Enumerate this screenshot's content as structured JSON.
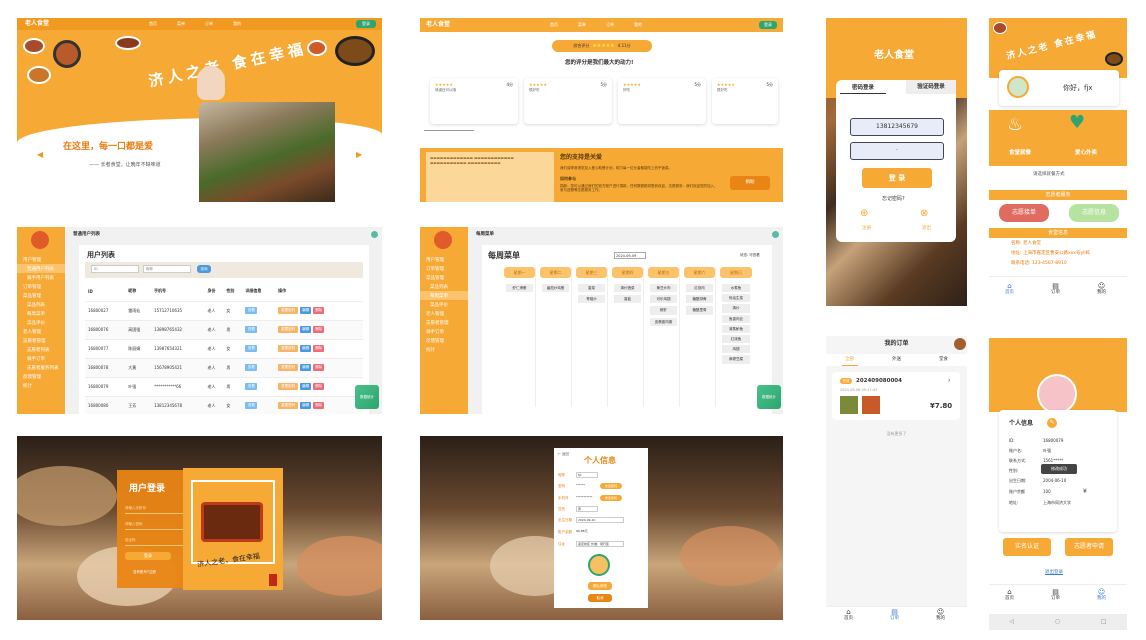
{
  "home": {
    "brand": "老人食堂",
    "nav": [
      "首页",
      "菜单",
      "订单",
      "我的"
    ],
    "login_btn": "登录",
    "banner_text": "济人之老 食在幸福",
    "slogan": "在这里，每一口都是爱",
    "sub_slogan": "—— 长者食堂，让晚年不缺味道"
  },
  "feedback": {
    "brand": "老人食堂",
    "nav": [
      "首页",
      "菜单",
      "订单",
      "我的"
    ],
    "login_btn": "登录",
    "rating_label": "综合评分",
    "rating_value": "4.11分",
    "headline": "您的评分是我们最大的动力!",
    "reviews": [
      {
        "score": "4分",
        "text": "味道还可以哦"
      },
      {
        "score": "5分",
        "text": "很好吃"
      },
      {
        "score": "5分",
        "text": "好吃"
      },
      {
        "score": "5分",
        "text": "很好吃"
      }
    ],
    "support_title": "您的支持是关爱",
    "support_text": "我们诚挚邀请您加入爱心助餐计划，助力每一位长者都能吃上热乎饭菜。",
    "support_subtitle": "如何参与",
    "support_detail": "捐款：您可以通过我们的官方账户进行捐款，任何数额都将受到欢迎。志愿服务：我们欢迎您的加入，参与送餐等志愿服务工作。",
    "support_btn": "捐助"
  },
  "mobile_login": {
    "brand": "老人食堂",
    "tab_password": "密码登录",
    "tab_code": "验证码登录",
    "phone_value": "13812345679",
    "password_value": "·",
    "login_btn": "登 录",
    "forgot": "忘记密码?",
    "register": "注册",
    "exit": "退出"
  },
  "mobile_home": {
    "banner_text": "济人之老 食在幸福",
    "greeting": "你好，fjx",
    "service1": "食堂就餐",
    "service2": "爱心外卖",
    "choose": "请选择就餐方式",
    "volunteer_section": "志愿者服务",
    "volunteer_order": "志愿接单",
    "volunteer_info": "志愿信息",
    "canteen_section": "食堂信息",
    "canteen_name_label": "名称:",
    "canteen_name": "老人食堂",
    "canteen_addr_label": "地址:",
    "canteen_addr": "上海市嘉定区曹安公路xxx号yll栋",
    "canteen_phone_label": "联系电话:",
    "canteen_phone": "123-4567-8910",
    "tabs": [
      "首页",
      "订单",
      "我的"
    ]
  },
  "admin_users": {
    "breadcrumb": "普通用户列表",
    "title": "用户列表",
    "search_btn": "查询",
    "search_placeholder": "ID",
    "search_placeholder2": "昵称",
    "sidebar": [
      "用户管理",
      "普通用户列表",
      "骑手用户列表",
      "订单管理",
      "菜品管理",
      "菜品列表",
      "每周菜单",
      "菜品评价",
      "老人管理",
      "志愿者管理",
      "志愿者列表",
      "骑手订单",
      "志愿者服务列表",
      "反馈管理",
      "统计"
    ],
    "columns": [
      "ID",
      "昵称",
      "手机号",
      "身份",
      "性别",
      "详细信息",
      "操作"
    ],
    "rows": [
      {
        "id": "16800027",
        "name": "雷雨仙",
        "phone": "15712710635",
        "role": "老人",
        "gender": "女"
      },
      {
        "id": "16800076",
        "name": "高国强",
        "phone": "13898765432",
        "role": "老人",
        "gender": "男"
      },
      {
        "id": "16800077",
        "name": "陈丽娟",
        "phone": "13987654321",
        "role": "老人",
        "gender": "女"
      },
      {
        "id": "16800078",
        "name": "大黄",
        "phone": "15678905421",
        "role": "老人",
        "gender": "男"
      },
      {
        "id": "16800079",
        "name": "叶强",
        "phone": "***********66",
        "role": "老人",
        "gender": "男"
      },
      {
        "id": "16800080",
        "name": "王芳",
        "phone": "13812345678",
        "role": "老人",
        "gender": "女"
      }
    ],
    "detail_btn": "查看",
    "op_edit": "重置密码",
    "op_a": "编辑",
    "op_b": "删除",
    "float_btn": "数据统计"
  },
  "admin_menu": {
    "breadcrumb": "每周菜单",
    "title": "每周菜单",
    "date": "2024-09-09",
    "right_label": "状态: 可查看",
    "days": [
      "星期一",
      "星期二",
      "星期三",
      "星期四",
      "星期五",
      "星期六",
      "星期日"
    ],
    "dishes": [
      [
        "虾仁滑蛋"
      ],
      [
        "番茄炒鸡蛋"
      ],
      [
        "香菜",
        "青椒炒"
      ],
      [
        "清炒菠菜",
        "香菇"
      ],
      [
        "黄豆炒肉",
        "可乐鸡翅",
        "鲜虾",
        "皮蛋瘦肉粥"
      ],
      [
        "红烧肉",
        "糖醋排骨",
        "糖醋里脊"
      ],
      [
        "水煮鱼",
        "蚝油生菜",
        "清炒",
        "鱼香肉丝",
        "清蒸鲈鱼",
        "红烧鱼",
        "鸡翅",
        "麻婆豆腐"
      ]
    ],
    "float_btn": "数据统计"
  },
  "web_login": {
    "title": "用户登录",
    "field1": "请输入手机号",
    "field2": "请输入密码",
    "field3": "验证码",
    "remember": "记住密码",
    "login_btn": "登录",
    "register": "没有账号?注册",
    "art_text": "济人之老，食在幸福"
  },
  "web_profile": {
    "back": "← 返回",
    "title": "个人信息",
    "fields": [
      {
        "label": "昵称",
        "value": "fjx"
      },
      {
        "label": "密码",
        "value": "******"
      },
      {
        "label": "手机号",
        "value": "***********"
      },
      {
        "label": "性别",
        "value": "男"
      },
      {
        "label": "出生日期",
        "value": "2024-09-10"
      },
      {
        "label": "账户余额",
        "value": "99.88元"
      },
      {
        "label": "住址",
        "value": "嘉定校区 外滩、闵行区"
      }
    ],
    "btn_change_pwd": "修改密码",
    "btn_change_phone": "修改手机",
    "save_btn": "确认修改",
    "cancel_btn": "取消"
  },
  "mobile_orders": {
    "title": "我的订单",
    "tabs": [
      "全部",
      "外送",
      "堂食"
    ],
    "status": "完成",
    "order_no": "202409080004",
    "time": "2024-09-08 09:27:43",
    "price": "¥7.80",
    "no_more": "没有更多了",
    "bottom_tabs": [
      "首页",
      "订单",
      "我的"
    ]
  },
  "mobile_profile": {
    "title": "个人信息",
    "rows": [
      {
        "label": "ID:",
        "value": "16800079"
      },
      {
        "label": "账户名:",
        "value": "叶强"
      },
      {
        "label": "联系方式:",
        "value": "1561*****"
      },
      {
        "label": "性别:",
        "value": "男"
      },
      {
        "label": "出生日期:",
        "value": "2004-06-10"
      },
      {
        "label": "账户余额",
        "value": "100"
      },
      {
        "label": "地址:",
        "value": "上海市同济大学"
      }
    ],
    "toast": "修改成功",
    "btn_real_name": "实名认证",
    "btn_volunteer": "志愿者申请",
    "logout": "退出登录",
    "bottom_tabs": [
      "首页",
      "订单",
      "我的"
    ]
  }
}
